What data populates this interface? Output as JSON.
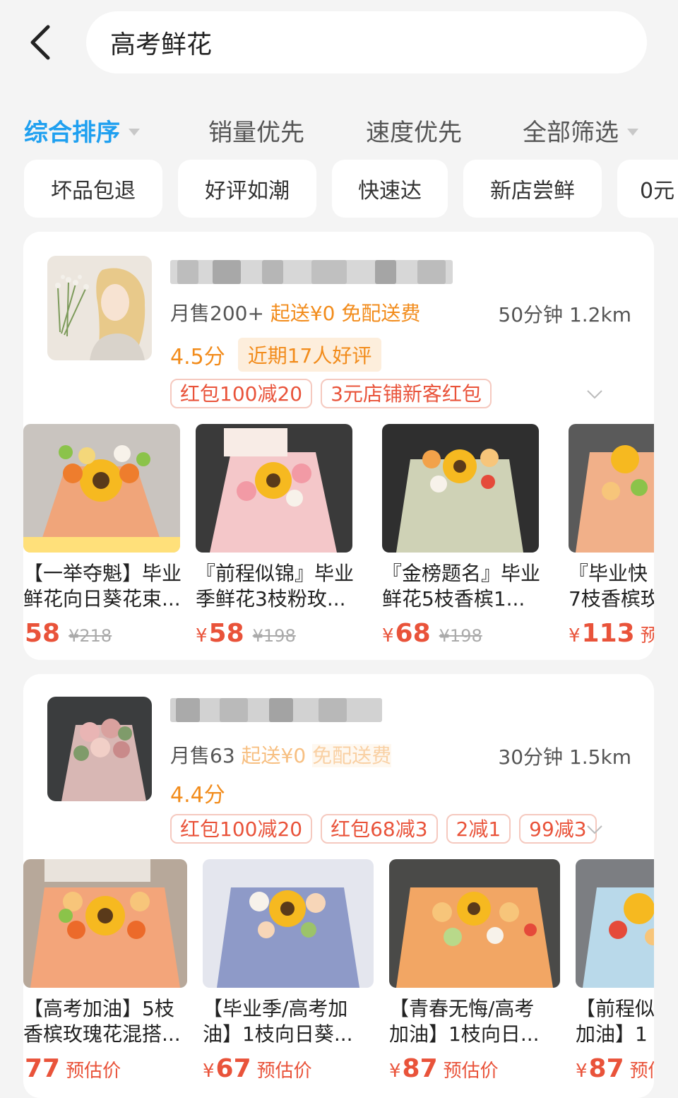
{
  "header": {
    "back_icon": "chevron-left-icon",
    "search_value": "高考鲜花"
  },
  "sort": [
    {
      "label": "综合排序",
      "active": true,
      "dropdown": true
    },
    {
      "label": "销量优先",
      "active": false,
      "dropdown": false
    },
    {
      "label": "速度优先",
      "active": false,
      "dropdown": false
    },
    {
      "label": "全部筛选",
      "active": false,
      "dropdown": true
    }
  ],
  "chips": [
    "坏品包退",
    "好评如潮",
    "快速达",
    "新店尝鲜",
    "0元"
  ],
  "colors": {
    "accent": "#1fa0f0",
    "orange": "#f28c1c",
    "price_red": "#e9533a"
  },
  "stores": [
    {
      "monthly_sales": "月售200+",
      "min_order": "起送¥0",
      "delivery_fee": "免配送费",
      "eta": "50分钟",
      "distance": "1.2km",
      "rating": "4.5分",
      "review_badge": "近期17人好评",
      "coupons": [
        "红包100减20",
        "3元店铺新客红包"
      ],
      "products": [
        {
          "name1": "【一举夺魁】毕业",
          "name2": "鲜花向日葵花束...",
          "currency": "¥",
          "price": "58",
          "orig": "¥218",
          "est": ""
        },
        {
          "name1": "『前程似锦』毕业",
          "name2": "季鲜花3枝粉玫...",
          "currency": "¥",
          "price": "58",
          "orig": "¥198",
          "est": ""
        },
        {
          "name1": "『金榜题名』毕业",
          "name2": "鲜花5枝香槟1...",
          "currency": "¥",
          "price": "68",
          "orig": "¥198",
          "est": ""
        },
        {
          "name1": "『毕业快",
          "name2": "7枝香槟玫",
          "currency": "¥",
          "price": "113",
          "orig": "",
          "est": "预估"
        }
      ]
    },
    {
      "monthly_sales": "月售63",
      "min_order": "起送¥0",
      "delivery_fee": "免配送费",
      "eta": "30分钟",
      "distance": "1.5km",
      "rating": "4.4分",
      "review_badge": "",
      "coupons": [
        "红包100减20",
        "红包68减3",
        "2减1",
        "99减3"
      ],
      "products": [
        {
          "name1": "【高考加油】5枝",
          "name2": "香槟玫瑰花混搭...",
          "currency": "¥",
          "price": "77",
          "orig": "",
          "est": "预估价"
        },
        {
          "name1": "【毕业季/高考加",
          "name2": "油】1枝向日葵...",
          "currency": "¥",
          "price": "67",
          "orig": "",
          "est": "预估价"
        },
        {
          "name1": "【青春无悔/高考",
          "name2": "加油】1枝向日...",
          "currency": "¥",
          "price": "87",
          "orig": "",
          "est": "预估价"
        },
        {
          "name1": "【前程似",
          "name2": "加油】1",
          "currency": "¥",
          "price": "87",
          "orig": "",
          "est": "预估"
        }
      ]
    }
  ]
}
